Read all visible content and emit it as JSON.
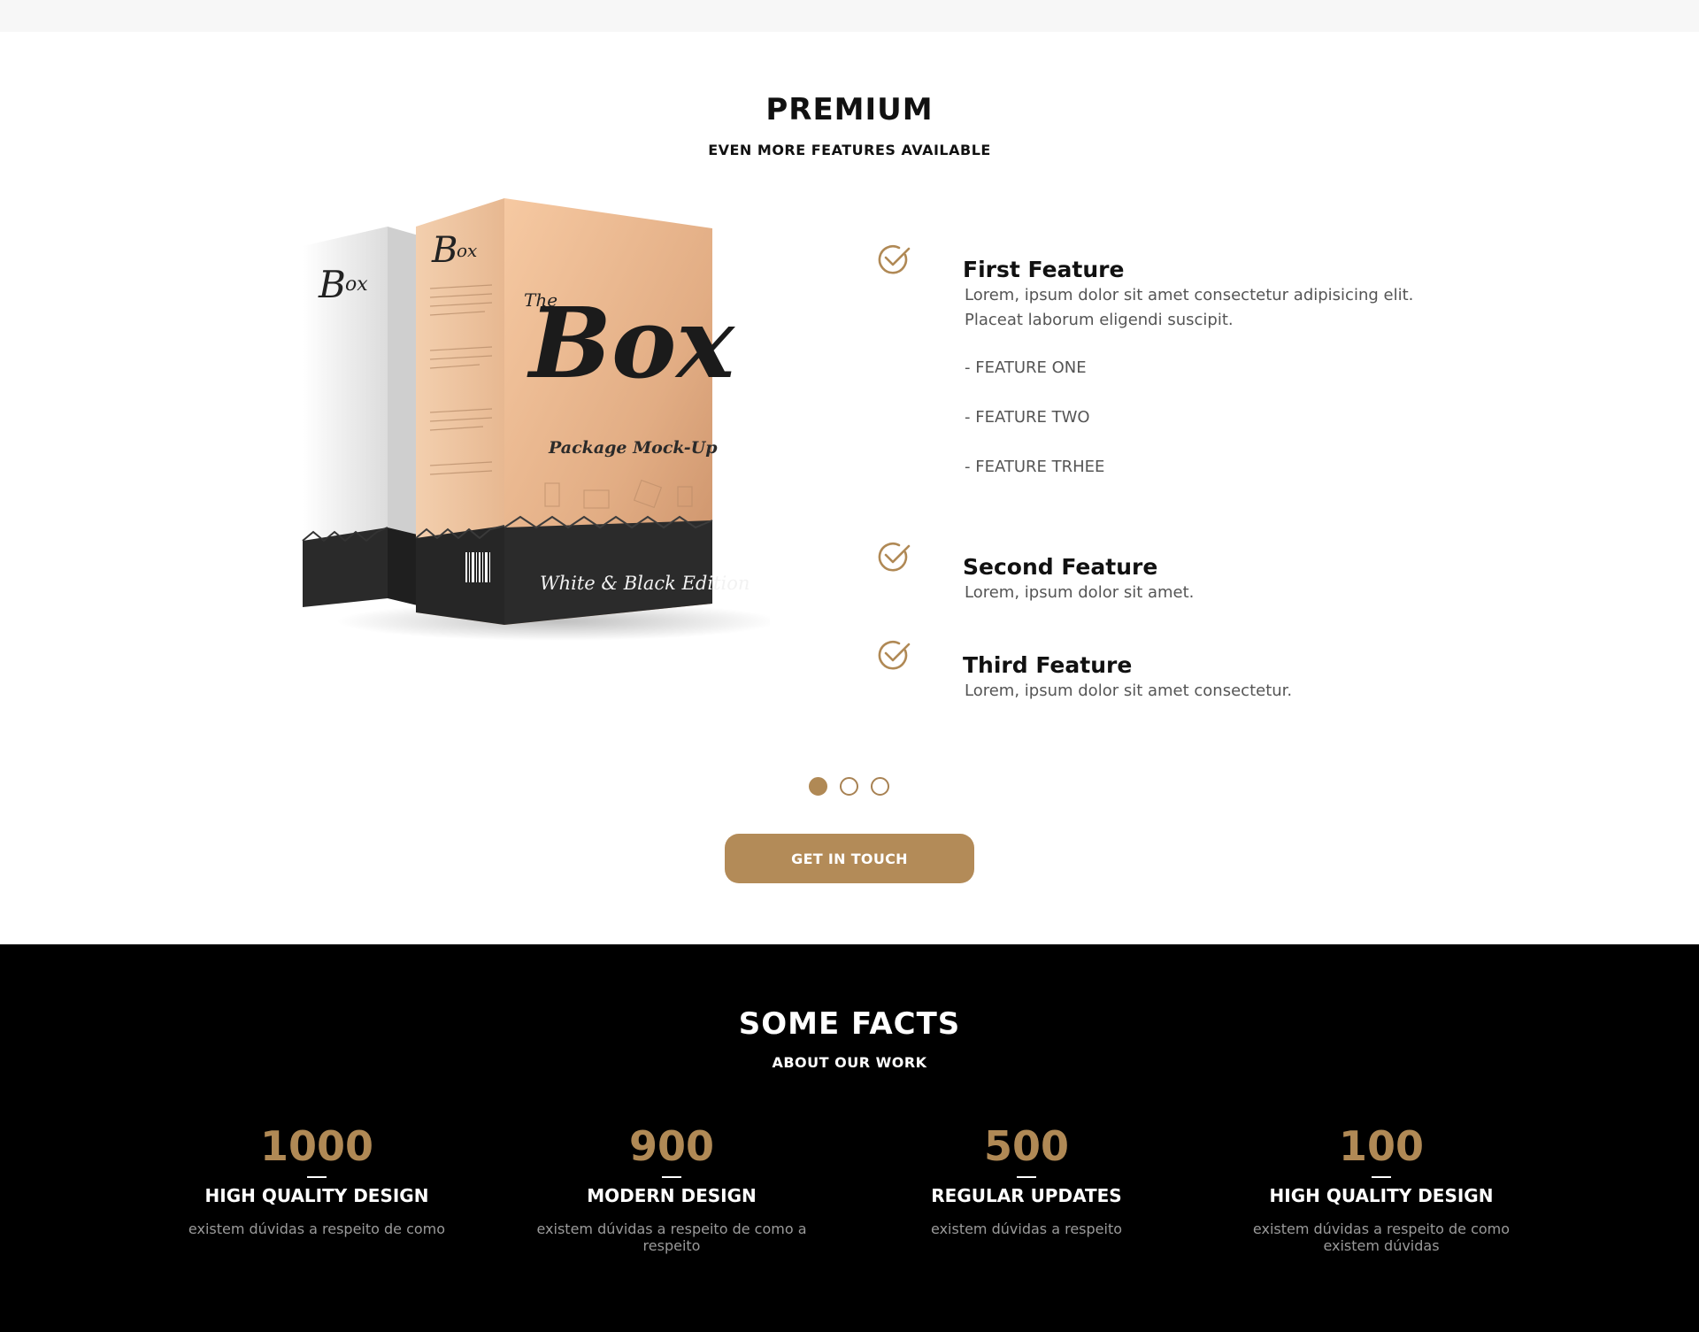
{
  "premium": {
    "title": "PREMIUM",
    "subtitle": "EVEN MORE FEATURES AVAILABLE",
    "product": {
      "box_front_brand_small": "The",
      "box_front_brand": "Box",
      "box_front_line": "Package Mock-Up",
      "box_front_edition": "White & Black Edition"
    },
    "features": [
      {
        "title": "First Feature",
        "desc": "Lorem, ipsum dolor sit amet consectetur adipisicing elit. Placeat laborum eligendi suscipit.",
        "items": [
          "- FEATURE ONE",
          "- FEATURE TWO",
          "- FEATURE TRHEE"
        ]
      },
      {
        "title": "Second Feature",
        "desc": "Lorem, ipsum dolor sit amet."
      },
      {
        "title": "Third Feature",
        "desc": "Lorem, ipsum dolor sit amet consectetur."
      }
    ],
    "carousel": {
      "active_index": 0,
      "count": 3
    },
    "cta_label": "GET IN TOUCH"
  },
  "facts": {
    "title": "SOME FACTS",
    "subtitle": "ABOUT OUR WORK",
    "items": [
      {
        "number": "1000",
        "label": "HIGH QUALITY DESIGN",
        "desc": "existem dúvidas a respeito de como"
      },
      {
        "number": "900",
        "label": "MODERN DESIGN",
        "desc": "existem dúvidas a respeito de como a respeito"
      },
      {
        "number": "500",
        "label": "REGULAR UPDATES",
        "desc": "existem dúvidas a respeito"
      },
      {
        "number": "100",
        "label": "HIGH QUALITY DESIGN",
        "desc": "existem dúvidas a respeito de como existem dúvidas"
      }
    ]
  },
  "colors": {
    "accent": "#b38b58",
    "dark_bg": "#000000",
    "muted_text": "#9a9a9a"
  },
  "icons": {
    "feature_check": "check-circle-icon"
  }
}
